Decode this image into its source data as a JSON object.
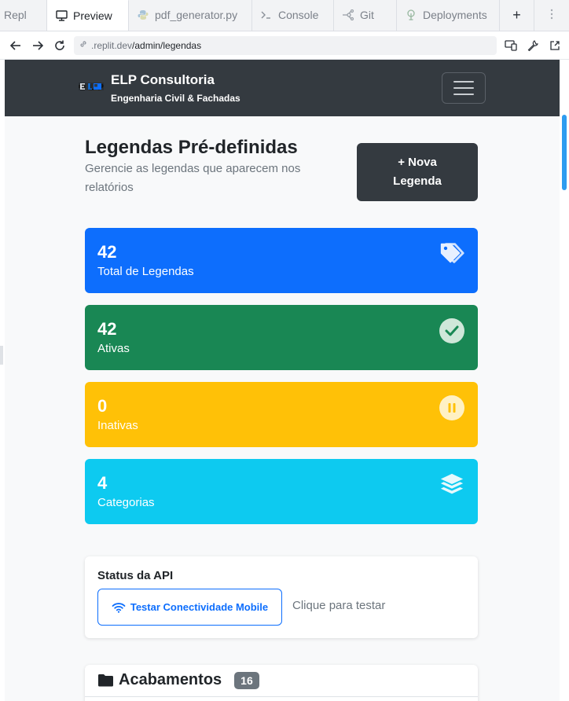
{
  "tabs": [
    {
      "label": "Repl",
      "icon": "none"
    },
    {
      "label": "Preview",
      "icon": "monitor-icon"
    },
    {
      "label": "pdf_generator.py",
      "icon": "python-icon"
    },
    {
      "label": "Console",
      "icon": "terminal-icon"
    },
    {
      "label": "Git",
      "icon": "git-icon"
    },
    {
      "label": "Deployments",
      "icon": "deploy-icon"
    }
  ],
  "address": {
    "url_prefix": ".replit.dev",
    "url_path": "/admin/legendas"
  },
  "navbar": {
    "logo": "ELP",
    "brand": "ELP Consultoria",
    "tagline": "Engenharia Civil & Fachadas"
  },
  "header": {
    "title": "Legendas Pré-definidas",
    "subtitle": "Gerencie as legendas que aparecem nos relatórios",
    "new_button_line1": "+ Nova",
    "new_button_line2": "Legenda"
  },
  "stats": [
    {
      "value": "42",
      "label": "Total de Legendas",
      "color": "#0d6efd",
      "icon": "tags-icon"
    },
    {
      "value": "42",
      "label": "Ativas",
      "color": "#198754",
      "icon": "check-circle-icon"
    },
    {
      "value": "0",
      "label": "Inativas",
      "color": "#ffc107",
      "icon": "pause-circle-icon"
    },
    {
      "value": "4",
      "label": "Categorias",
      "color": "#0dcaf0",
      "icon": "layers-icon"
    }
  ],
  "api": {
    "title": "Status da API",
    "button": "Testar Conectividade Mobile",
    "hint": "Clique para testar"
  },
  "category": {
    "name": "Acabamentos",
    "count": "16"
  }
}
